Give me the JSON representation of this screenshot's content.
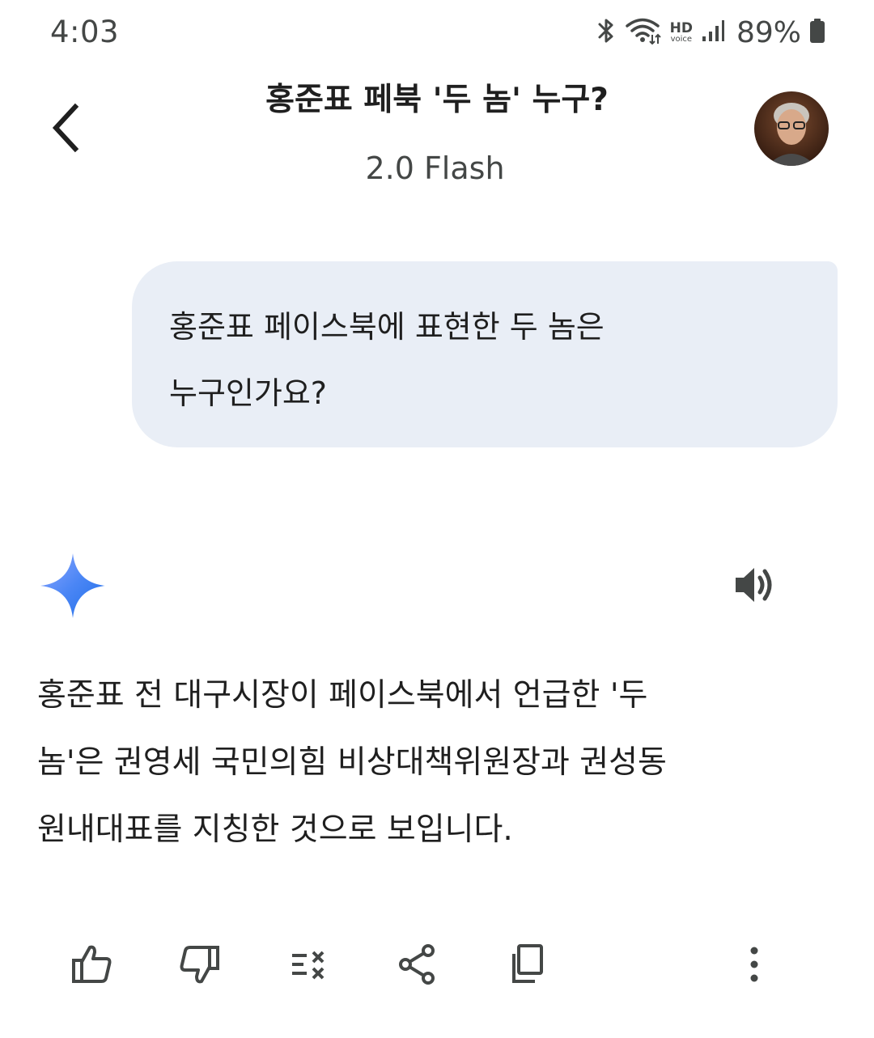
{
  "status_bar": {
    "time": "4:03",
    "hd_label": "HD",
    "voice_label": "voice",
    "battery_percent": "89%",
    "icons": [
      "bluetooth-icon",
      "wifi-icon",
      "hd-voice-icon",
      "signal-icon",
      "battery-icon"
    ]
  },
  "header": {
    "title": "홍준표 페북 '두 놈' 누구?",
    "model": "2.0 Flash",
    "back_icon": "back-arrow-icon",
    "avatar": "user-avatar"
  },
  "conversation": {
    "user_message": {
      "line1": "홍준표 페이스북에 표현한 두 놈은",
      "line2": "누구인가요?"
    },
    "response": {
      "icon": "gemini-sparkle-icon",
      "line1": "홍준표 전 대구시장이 페이스북에서 언급한 '두",
      "line2": "놈'은 권영세 국민의힘 비상대책위원장과 권성동",
      "line3": "원내대표를 지칭한 것으로 보입니다."
    }
  },
  "actions": [
    "thumbs-up-icon",
    "thumbs-down-icon",
    "modify-response-icon",
    "share-icon",
    "copy-icon",
    "more-options-icon"
  ],
  "colors": {
    "bubble": "#e9eef6",
    "text": "#1f1f1f",
    "secondary_text": "#444746",
    "icon": "#444746",
    "sparkle_start": "#5b8cf7",
    "sparkle_end": "#2f6cf0"
  }
}
